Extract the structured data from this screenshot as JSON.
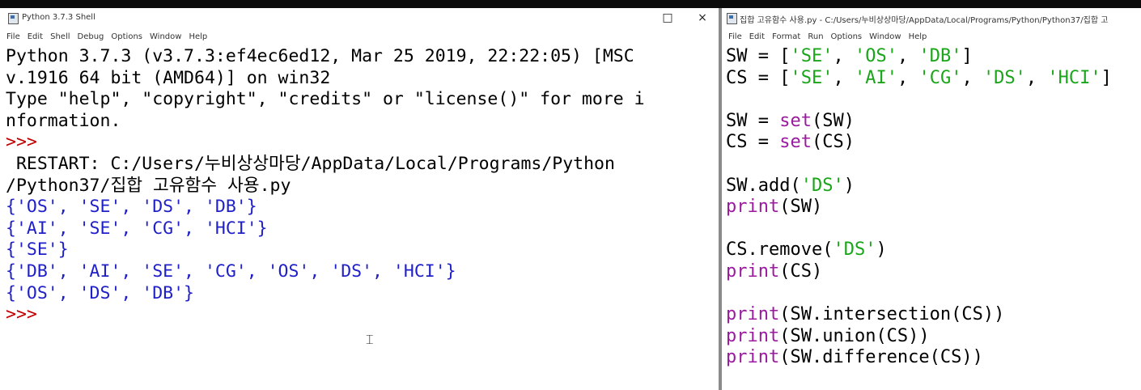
{
  "shell": {
    "title": "Python 3.7.3 Shell",
    "menu": [
      "File",
      "Edit",
      "Shell",
      "Debug",
      "Options",
      "Window",
      "Help"
    ],
    "lines": [
      {
        "kind": "normal",
        "text": "Python 3.7.3 (v3.7.3:ef4ec6ed12, Mar 25 2019, 22:22:05) [MSC"
      },
      {
        "kind": "normal",
        "text": "v.1916 64 bit (AMD64)] on win32"
      },
      {
        "kind": "normal",
        "text": "Type \"help\", \"copyright\", \"credits\" or \"license()\" for more i"
      },
      {
        "kind": "normal",
        "text": "nformation."
      },
      {
        "kind": "prompt",
        "text": ">>>"
      },
      {
        "kind": "normal",
        "text": " RESTART: C:/Users/누비상상마당/AppData/Local/Programs/Python"
      },
      {
        "kind": "normal",
        "text": "/Python37/집합 고유함수 사용.py"
      },
      {
        "kind": "output",
        "text": "{'OS', 'SE', 'DS', 'DB'}"
      },
      {
        "kind": "output",
        "text": "{'AI', 'SE', 'CG', 'HCI'}"
      },
      {
        "kind": "output",
        "text": "{'SE'}"
      },
      {
        "kind": "output",
        "text": "{'DB', 'AI', 'SE', 'CG', 'OS', 'DS', 'HCI'}"
      },
      {
        "kind": "output",
        "text": "{'OS', 'DS', 'DB'}"
      },
      {
        "kind": "prompt",
        "text": ">>>"
      }
    ]
  },
  "editor": {
    "title": "집합 고유함수 사용.py - C:/Users/누비상상마당/AppData/Local/Programs/Python/Python37/집합 고",
    "menu": [
      "File",
      "Edit",
      "Format",
      "Run",
      "Options",
      "Window",
      "Help"
    ],
    "lines": [
      [
        {
          "t": "SW = [",
          "c": "n"
        },
        {
          "t": "'SE'",
          "c": "s"
        },
        {
          "t": ", ",
          "c": "n"
        },
        {
          "t": "'OS'",
          "c": "s"
        },
        {
          "t": ", ",
          "c": "n"
        },
        {
          "t": "'DB'",
          "c": "s"
        },
        {
          "t": "]",
          "c": "n"
        }
      ],
      [
        {
          "t": "CS = [",
          "c": "n"
        },
        {
          "t": "'SE'",
          "c": "s"
        },
        {
          "t": ", ",
          "c": "n"
        },
        {
          "t": "'AI'",
          "c": "s"
        },
        {
          "t": ", ",
          "c": "n"
        },
        {
          "t": "'CG'",
          "c": "s"
        },
        {
          "t": ", ",
          "c": "n"
        },
        {
          "t": "'DS'",
          "c": "s"
        },
        {
          "t": ", ",
          "c": "n"
        },
        {
          "t": "'HCI'",
          "c": "s"
        },
        {
          "t": "]",
          "c": "n"
        }
      ],
      [],
      [
        {
          "t": "SW = ",
          "c": "n"
        },
        {
          "t": "set",
          "c": "b"
        },
        {
          "t": "(SW)",
          "c": "n"
        }
      ],
      [
        {
          "t": "CS = ",
          "c": "n"
        },
        {
          "t": "set",
          "c": "b"
        },
        {
          "t": "(CS)",
          "c": "n"
        }
      ],
      [],
      [
        {
          "t": "SW.add(",
          "c": "n"
        },
        {
          "t": "'DS'",
          "c": "s"
        },
        {
          "t": ")",
          "c": "n"
        }
      ],
      [
        {
          "t": "print",
          "c": "b"
        },
        {
          "t": "(SW)",
          "c": "n"
        }
      ],
      [],
      [
        {
          "t": "CS.remove(",
          "c": "n"
        },
        {
          "t": "'DS'",
          "c": "s"
        },
        {
          "t": ")",
          "c": "n"
        }
      ],
      [
        {
          "t": "print",
          "c": "b"
        },
        {
          "t": "(CS)",
          "c": "n"
        }
      ],
      [],
      [
        {
          "t": "print",
          "c": "b"
        },
        {
          "t": "(SW.intersection(CS))",
          "c": "n"
        }
      ],
      [
        {
          "t": "print",
          "c": "b"
        },
        {
          "t": "(SW.union(CS))",
          "c": "n"
        }
      ],
      [
        {
          "t": "print",
          "c": "b"
        },
        {
          "t": "(SW.difference(CS))",
          "c": "n"
        }
      ]
    ]
  },
  "colors": {
    "output": "#2020c8",
    "prompt": "#c00000",
    "string": "#1aa51a",
    "builtin": "#9a1aa0"
  }
}
